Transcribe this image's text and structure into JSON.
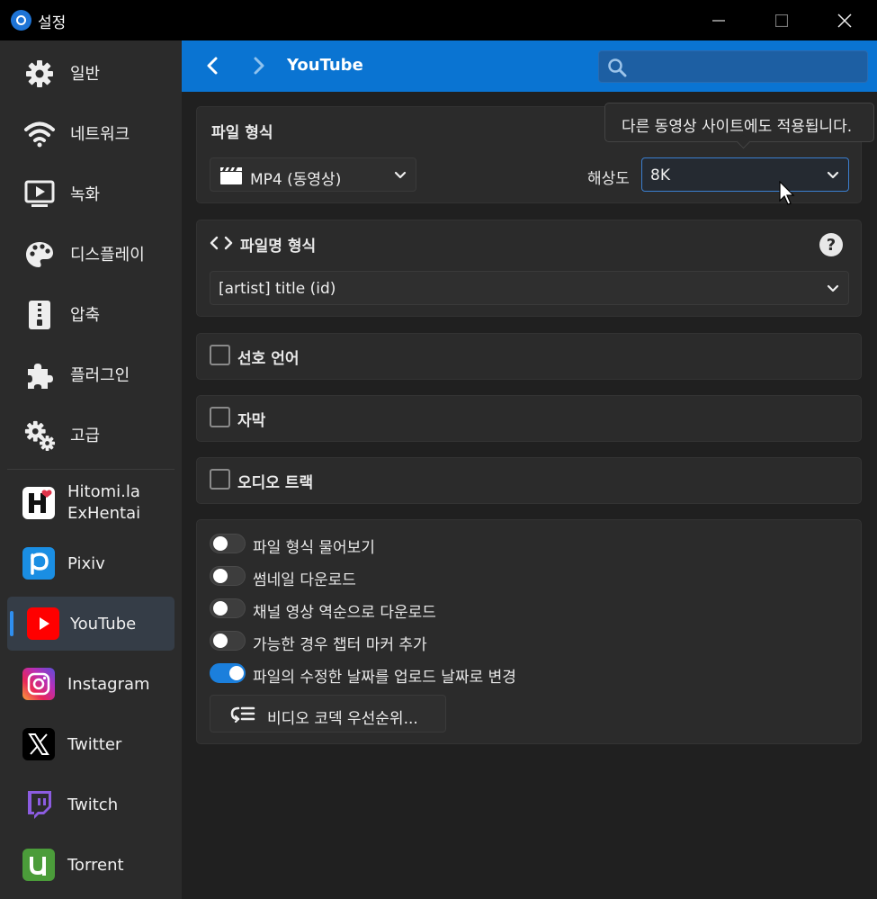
{
  "window": {
    "title": "설정"
  },
  "sidebar": {
    "items": [
      {
        "label": "일반",
        "icon": "gear-icon"
      },
      {
        "label": "네트워크",
        "icon": "wifi-icon"
      },
      {
        "label": "녹화",
        "icon": "play-screen-icon"
      },
      {
        "label": "디스플레이",
        "icon": "palette-icon"
      },
      {
        "label": "압축",
        "icon": "zip-icon"
      },
      {
        "label": "플러그인",
        "icon": "puzzle-icon"
      },
      {
        "label": "고급",
        "icon": "gears-icon"
      }
    ],
    "sites": [
      {
        "label_line1": "Hitomi.la",
        "label_line2": "ExHentai",
        "icon": "hitomi-icon"
      },
      {
        "label": "Pixiv",
        "icon": "pixiv-icon"
      },
      {
        "label": "YouTube",
        "icon": "youtube-icon",
        "active": true
      },
      {
        "label": "Instagram",
        "icon": "instagram-icon"
      },
      {
        "label": "Twitter",
        "icon": "twitter-x-icon"
      },
      {
        "label": "Twitch",
        "icon": "twitch-icon"
      },
      {
        "label": "Torrent",
        "icon": "utorrent-icon"
      }
    ]
  },
  "header": {
    "title": "YouTube",
    "search_placeholder": ""
  },
  "format_card": {
    "title": "파일 형식",
    "format_value": "MP4   (동영상)",
    "resolution_label": "해상도",
    "resolution_value": "8K"
  },
  "tooltip": {
    "text": "다른 동영상 사이트에도 적용됩니다."
  },
  "filename_card": {
    "title": "파일명 형식",
    "value": "[artist] title (id)"
  },
  "checkboxes": {
    "preferred_language": "선호 언어",
    "subtitles": "자막",
    "audio_track": "오디오 트랙"
  },
  "options": {
    "toggles": [
      {
        "label": "파일 형식 물어보기",
        "on": false
      },
      {
        "label": "썸네일 다운로드",
        "on": false
      },
      {
        "label": "채널 영상 역순으로 다운로드",
        "on": false
      },
      {
        "label": "가능한 경우 챕터 마커 추가",
        "on": false
      },
      {
        "label": "파일의 수정한 날짜를 업로드 날짜로 변경",
        "on": true
      }
    ],
    "codec_button": "비디오 코덱 우선순위..."
  },
  "colors": {
    "accent": "#0a74d2",
    "toggle_on": "#1b7fdc"
  }
}
